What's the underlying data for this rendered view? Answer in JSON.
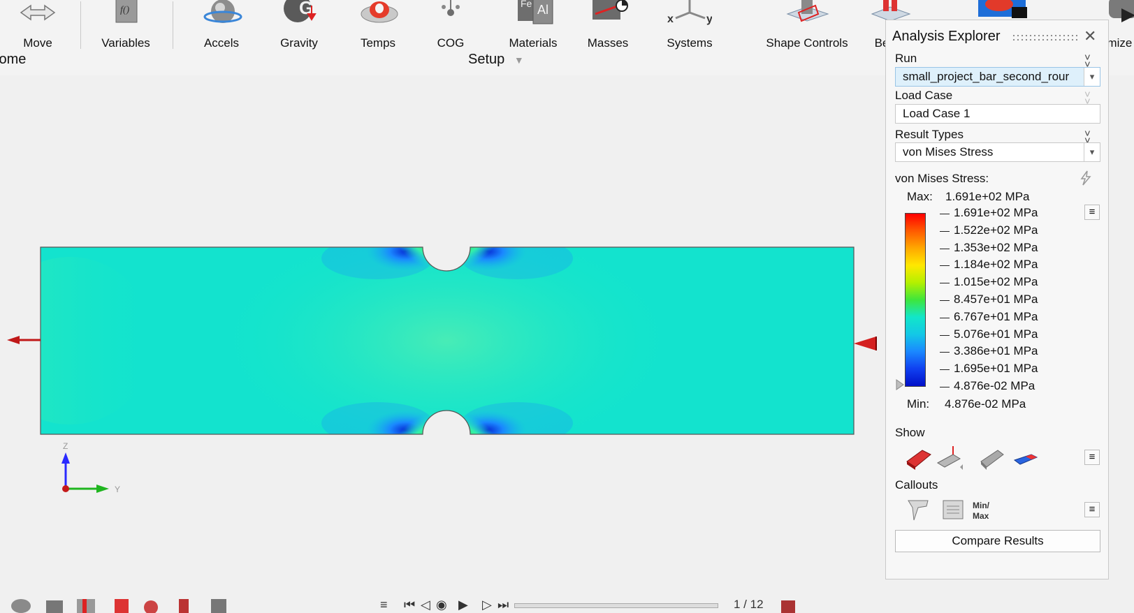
{
  "ribbon": {
    "tools": [
      {
        "label": "Move",
        "icon": "move-icon"
      },
      {
        "label": "Variables",
        "icon": "variables-icon"
      },
      {
        "label": "Accels",
        "icon": "accels-icon"
      },
      {
        "label": "Gravity",
        "icon": "gravity-icon"
      },
      {
        "label": "Temps",
        "icon": "temps-icon"
      },
      {
        "label": "COG",
        "icon": "cog-icon"
      },
      {
        "label": "Materials",
        "icon": "materials-icon"
      },
      {
        "label": "Masses",
        "icon": "masses-icon"
      },
      {
        "label": "Systems",
        "icon": "systems-icon"
      },
      {
        "label": "Shape Controls",
        "icon": "shape-controls-icon"
      },
      {
        "label": "Be",
        "icon": "bearing-icon"
      },
      {
        "label": "imize",
        "icon": "optimize-icon"
      }
    ],
    "groups": {
      "home": "lome",
      "setup": "Setup"
    },
    "system_axis_labels": {
      "x": "x",
      "y": "y"
    },
    "materials_icon_text": {
      "fe": "Fe",
      "al": "Al"
    },
    "gravity_icon_text": "G"
  },
  "viewport": {
    "triad": {
      "z": "Z",
      "y": "Y"
    },
    "contour_colors": {
      "min": "#0010c8",
      "mid": "#12e6c9",
      "max": "#ff0000"
    }
  },
  "explorer": {
    "title": "Analysis Explorer",
    "run": {
      "label": "Run",
      "value": "small_project_bar_second_rour"
    },
    "load_case": {
      "label": "Load Case",
      "value": "Load Case 1"
    },
    "result_types": {
      "label": "Result Types",
      "value": "von Mises Stress"
    },
    "legend": {
      "title": "von Mises Stress:",
      "max_label": "Max:",
      "max_value": "1.691e+02 MPa",
      "min_label": "Min:",
      "min_value": "4.876e-02 MPa",
      "levels": [
        "1.691e+02 MPa",
        "1.522e+02 MPa",
        "1.353e+02 MPa",
        "1.184e+02 MPa",
        "1.015e+02 MPa",
        "8.457e+01 MPa",
        "6.767e+01 MPa",
        "5.076e+01 MPa",
        "3.386e+01 MPa",
        "1.695e+01 MPa",
        "4.876e-02 MPa"
      ],
      "band_colors": [
        "#ff0000",
        "#ff5a00",
        "#ffa800",
        "#ffe800",
        "#b4f000",
        "#3ee63c",
        "#12e6c9",
        "#13c8e6",
        "#1a88ff",
        "#1040f0",
        "#0010c8"
      ]
    },
    "show": {
      "label": "Show"
    },
    "callouts": {
      "label": "Callouts",
      "minmax_text_1": "Min/",
      "minmax_text_2": "Max"
    },
    "compare_button": "Compare Results"
  },
  "bottombar": {
    "frame": "1 / 12"
  }
}
